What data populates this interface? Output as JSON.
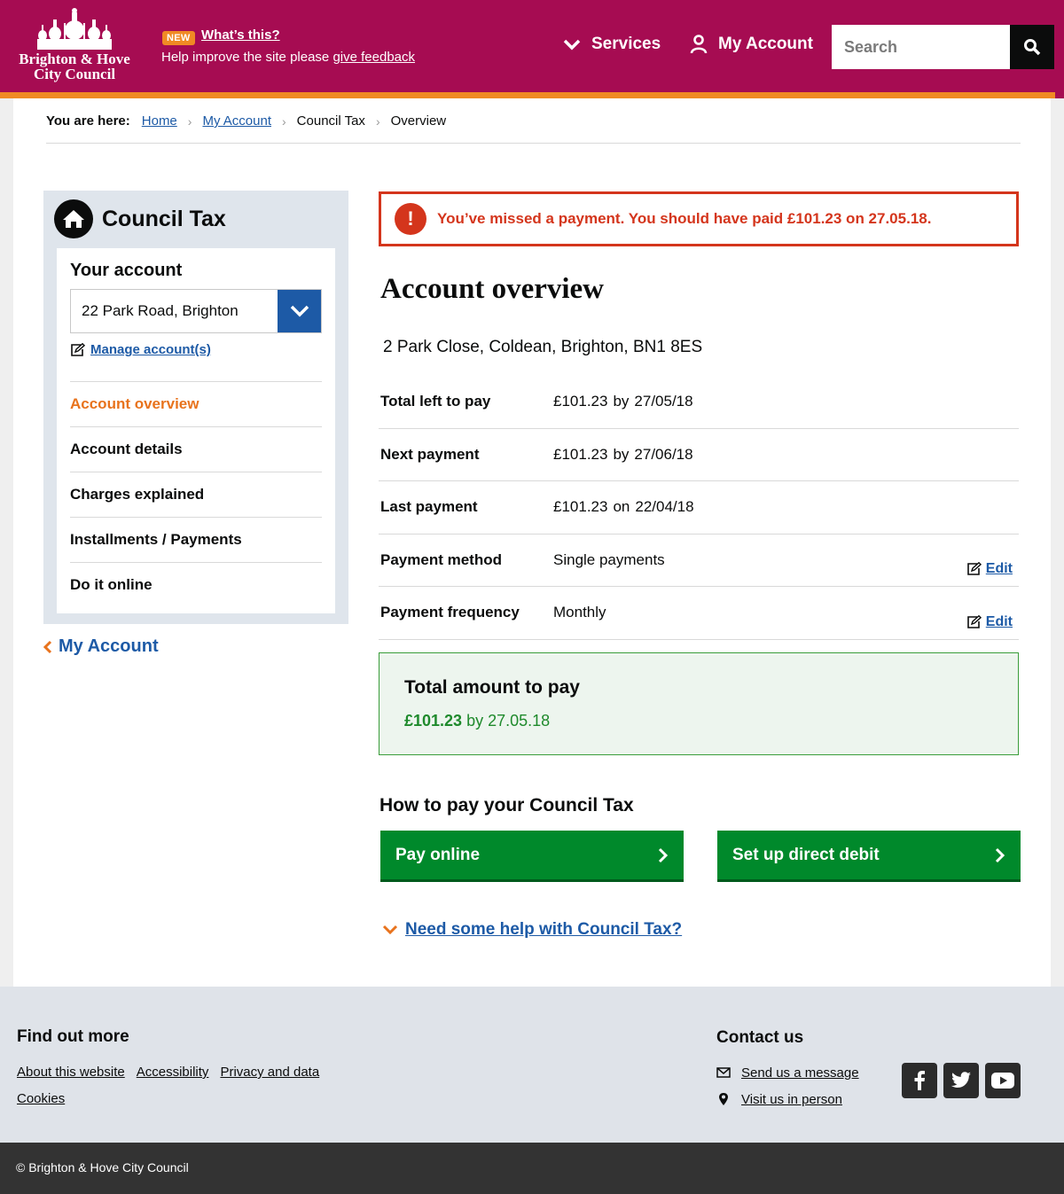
{
  "header": {
    "logo_line1": "Brighton & Hove",
    "logo_line2": "City Council",
    "new_badge": "NEW",
    "whats_this": "What’s this?",
    "feedback_prefix": "Help improve the site please ",
    "feedback_link": "give feedback",
    "services_label": "Services",
    "account_label": "My Account",
    "search_placeholder": "Search"
  },
  "breadcrumb": {
    "label": "You are here:",
    "items": [
      "Home",
      "My Account",
      "Council Tax",
      "Overview"
    ]
  },
  "sidebar": {
    "title": "Council Tax",
    "your_account": "Your account",
    "selected_account": "22 Park Road, Brighton",
    "manage_link": "Manage account(s)",
    "nav": [
      "Account overview",
      "Account details",
      "Charges explained",
      "Installments / Payments",
      "Do it online"
    ],
    "back_link": "My Account"
  },
  "alert": {
    "icon": "!",
    "message": "You’ve missed a payment. You should have paid £101.23 on 27.05.18."
  },
  "overview": {
    "title": "Account overview",
    "address": "2 Park Close, Coldean, Brighton, BN1 8ES",
    "rows": [
      {
        "label": "Total left to pay",
        "amount": "£101.23",
        "word": "by",
        "date": "27/05/18"
      },
      {
        "label": "Next payment",
        "amount": "£101.23",
        "word": "by",
        "date": "27/06/18"
      },
      {
        "label": "Last payment",
        "amount": "£101.23",
        "word": "on",
        "date": "22/04/18"
      },
      {
        "label": "Payment method",
        "value": "Single payments",
        "edit": "Edit"
      },
      {
        "label": "Payment frequency",
        "value": "Monthly",
        "edit": "Edit"
      }
    ]
  },
  "total": {
    "title": "Total amount to pay",
    "amount": "£101.23",
    "suffix": " by 27.05.18"
  },
  "how_to_pay": {
    "title": "How to pay your Council Tax",
    "pay_online": "Pay online",
    "direct_debit": "Set up direct debit",
    "help_link": "Need some help with Council Tax?"
  },
  "footer": {
    "find_out_more": "Find out more",
    "links": [
      "About this website",
      "Accessibility",
      "Privacy and data",
      "Cookies"
    ],
    "contact_us": "Contact us",
    "send_message": "Send us a message",
    "visit": "Visit us in person",
    "copyright": "© Brighton & Hove City Council"
  },
  "colors": {
    "brand": "#a60c52",
    "accent": "#f08a24",
    "link": "#1d5aa6",
    "error": "#d4351c",
    "success": "#00892b"
  }
}
